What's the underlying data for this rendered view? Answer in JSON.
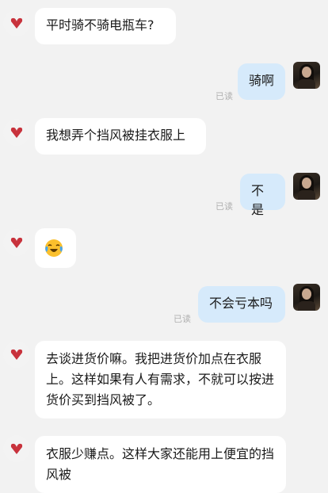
{
  "chat": {
    "read_label": "已读",
    "messages": [
      {
        "side": "left",
        "text": "平时骑不骑电瓶车?"
      },
      {
        "side": "right",
        "text": "骑啊"
      },
      {
        "side": "left",
        "text": "我想弄个挡风被挂衣服上"
      },
      {
        "side": "right",
        "text": "不是"
      },
      {
        "side": "left",
        "emoji": "crying-laughing-emoji"
      },
      {
        "side": "right",
        "text": "不会亏本吗"
      },
      {
        "side": "left",
        "text": "去谈进货价嘛。我把进货价加点在衣服上。这样如果有人有需求，不就可以按进货价买到挡风被了。"
      },
      {
        "side": "left",
        "text": "衣服少赚点。这样大家还能用上便宜的挡风被"
      }
    ]
  },
  "colors": {
    "left_bubble": "#ffffff",
    "right_bubble": "#d6eafb",
    "background": "#f2f2f2",
    "avatar_icon": "#c8323c"
  }
}
